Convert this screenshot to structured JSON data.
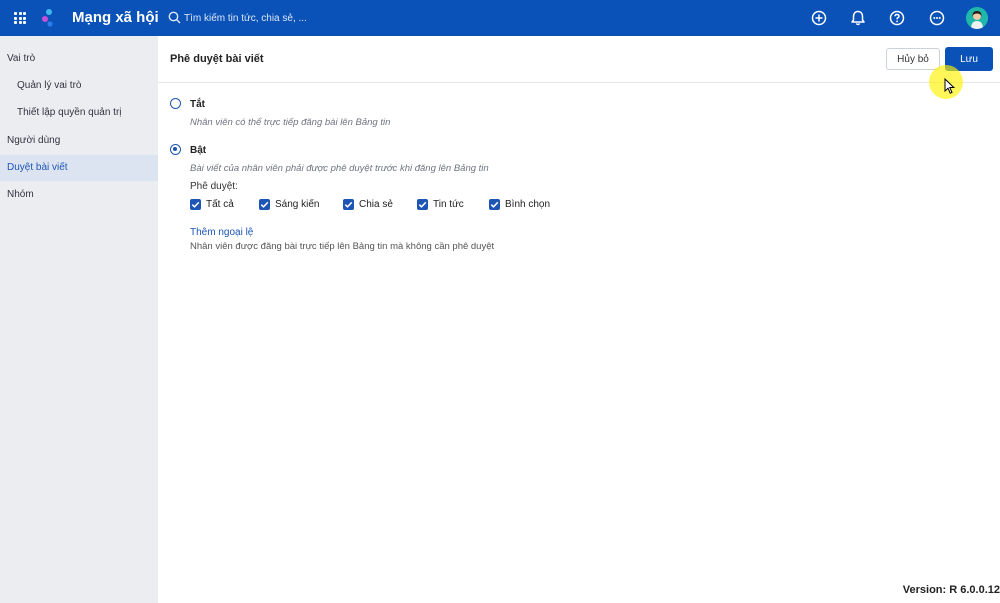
{
  "header": {
    "app_title": "Mạng xã hội",
    "search_placeholder": "Tìm kiếm tin tức, chia sẻ, ..."
  },
  "sidebar": {
    "items": [
      {
        "label": "Vai trò"
      },
      {
        "label": "Quản lý vai trò"
      },
      {
        "label": "Thiết lập quyền quản trị"
      },
      {
        "label": "Người dùng"
      },
      {
        "label": "Duyệt bài viết"
      },
      {
        "label": "Nhóm"
      }
    ]
  },
  "main": {
    "title": "Phê duyệt bài viết",
    "cancel_label": "Hủy bỏ",
    "save_label": "Lưu",
    "option_off": {
      "label": "Tắt",
      "description": "Nhân viên có thể trực tiếp đăng bài lên Bảng tin",
      "selected": false
    },
    "option_on": {
      "label": "Bật",
      "description": "Bài viết của nhân viên phải được phê duyệt trước khi đăng lên Bảng tin",
      "selected": true
    },
    "approve_label": "Phê duyệt:",
    "checkboxes": [
      {
        "label": "Tất cả",
        "checked": true
      },
      {
        "label": "Sáng kiến",
        "checked": true
      },
      {
        "label": "Chia sẻ",
        "checked": true
      },
      {
        "label": "Tin tức",
        "checked": true
      },
      {
        "label": "Bình chọn",
        "checked": true
      }
    ],
    "exception_link": "Thêm ngoại lệ",
    "exception_description": "Nhân viên được đăng bài trực tiếp lên Bảng tin mà không cần phê duyệt"
  },
  "footer": {
    "version": "Version: R 6.0.0.12"
  },
  "colors": {
    "primary": "#0a52b8",
    "sidebar_bg": "#ecedf1",
    "sidebar_active_bg": "#dde4f1",
    "link": "#1d55b5"
  }
}
